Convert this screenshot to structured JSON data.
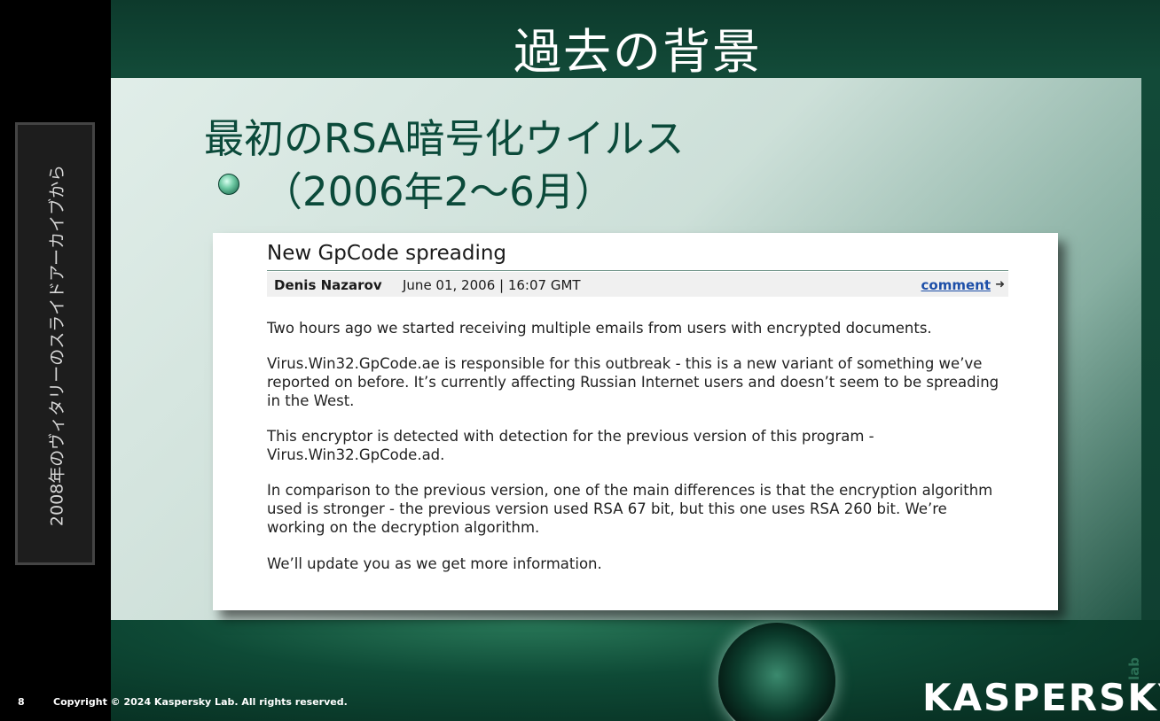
{
  "slide": {
    "title": "過去の背景",
    "heading_line1": "最初のRSA暗号化ウイルス",
    "heading_line2": "（2006年2～6月）"
  },
  "side_panel": {
    "label": "2008年のヴィタリーのスライドアーカイブから"
  },
  "article": {
    "title": "New GpCode spreading",
    "author": "Denis Nazarov",
    "date": "June 01, 2006 | 16:07  GMT",
    "comment_link": "comment",
    "paragraphs": [
      "Two hours ago we started receiving multiple emails from users with encrypted documents.",
      "Virus.Win32.GpCode.ae is responsible for this outbreak - this is a new variant of something we’ve reported on before. It’s currently affecting Russian Internet users and doesn’t seem to be spreading in the West.",
      "This encryptor is detected with detection for the previous version of this program - Virus.Win32.GpCode.ad.",
      "In comparison to the previous version, one of the main differences is that the encryption algorithm used is stronger - the previous version used RSA 67 bit, but this one uses RSA 260 bit. We’re working on the decryption algorithm.",
      "We’ll update you as we get more information."
    ]
  },
  "footer": {
    "page_number": "8",
    "copyright": "Copyright © 2024 Kaspersky Lab. All rights reserved."
  },
  "logo": {
    "text": "KASPERSKY",
    "suffix": "lab"
  },
  "colors": {
    "heading": "#0b4a3a",
    "link": "#1d4fa8",
    "slide_dark": "#0f3e30"
  }
}
